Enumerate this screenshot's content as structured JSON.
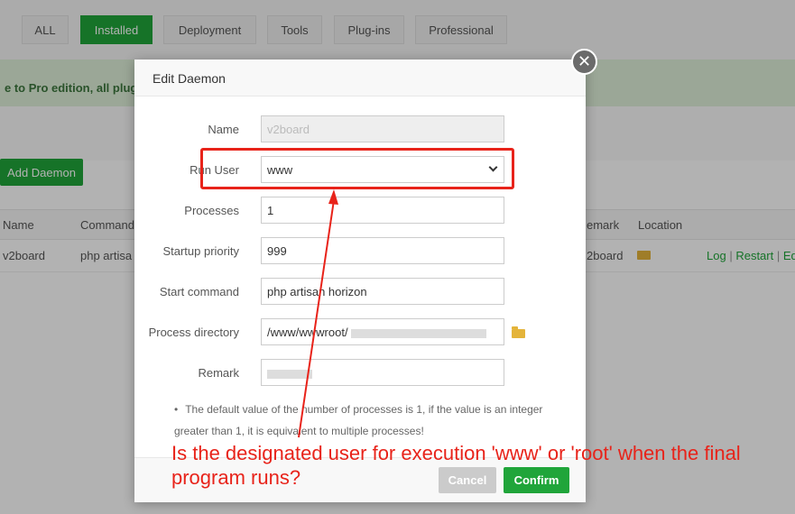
{
  "tabs": [
    "ALL",
    "Installed",
    "Deployment",
    "Tools",
    "Plug-ins",
    "Professional"
  ],
  "notice": "e to Pro edition, all plugin",
  "add_daemon_label": "Add Daemon",
  "table": {
    "headers": [
      "Name",
      "Command",
      "emark",
      "Location"
    ],
    "row": {
      "name": "v2board",
      "command": "php artisa",
      "remark": "2board",
      "links": [
        "Log",
        "Restart",
        "Edi"
      ]
    }
  },
  "modal": {
    "title": "Edit Daemon",
    "close_icon": "close-icon",
    "fields": {
      "name_label": "Name",
      "name_value": "v2board",
      "run_user_label": "Run User",
      "run_user_value": "www",
      "processes_label": "Processes",
      "processes_value": "1",
      "priority_label": "Startup priority",
      "priority_value": "999",
      "command_label": "Start command",
      "command_value": "php artisan horizon",
      "directory_label": "Process directory",
      "directory_value": "/www/wwwroot/",
      "remark_label": "Remark"
    },
    "tip": "The default value of the number of processes is 1, if the value is an integer greater than 1, it is equivalent to multiple processes!",
    "cancel_label": "Cancel",
    "confirm_label": "Confirm"
  },
  "annotation": {
    "question": "Is the designated user for execution 'www' or 'root' when the final program runs?",
    "color": "#e8231a"
  },
  "colors": {
    "accent": "#20a53a",
    "folder": "#e4b43a"
  }
}
